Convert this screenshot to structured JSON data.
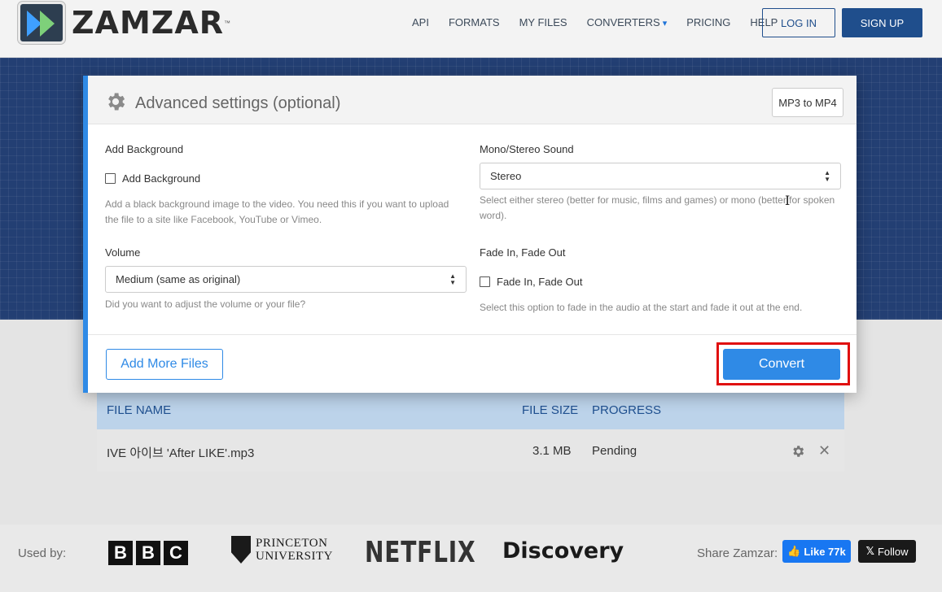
{
  "header": {
    "logo_text": "ZAMZAR",
    "logo_tm": "™",
    "nav": [
      "API",
      "FORMATS",
      "MY FILES",
      "CONVERTERS",
      "PRICING",
      "HELP"
    ],
    "login_label": "LOG IN",
    "signup_label": "SIGN UP"
  },
  "modal": {
    "title": "Advanced settings (optional)",
    "conversion_badge": "MP3 to MP4",
    "add_background": {
      "label": "Add Background",
      "checkbox_label": "Add Background",
      "checked": false,
      "help": "Add a black background image to the video. You need this if you want to upload the file to a site like Facebook, YouTube or Vimeo."
    },
    "mono_stereo": {
      "label": "Mono/Stereo Sound",
      "selected": "Stereo",
      "help": "Select either stereo (better for music, films and games) or mono (better for spoken word)."
    },
    "volume": {
      "label": "Volume",
      "selected": "Medium (same as original)",
      "help": "Did you want to adjust the volume or your file?"
    },
    "fade": {
      "label": "Fade In, Fade Out",
      "checkbox_label": "Fade In, Fade Out",
      "checked": false,
      "help": "Select this option to fade in the audio at the start and fade it out at the end."
    },
    "add_more_label": "Add More Files",
    "convert_label": "Convert"
  },
  "file_table": {
    "headers": [
      "FILE NAME",
      "FILE SIZE",
      "PROGRESS"
    ],
    "rows": [
      {
        "name": "IVE 아이브 'After LIKE'.mp3",
        "size": "3.1 MB",
        "progress": "Pending"
      }
    ]
  },
  "footer": {
    "used_by": "Used by:",
    "brands": [
      "BBC",
      "PRINCETON UNIVERSITY",
      "NETFLIX",
      "Discovery"
    ],
    "share_label": "Share Zamzar:",
    "like_label": "Like 77k",
    "follow_label": "Follow"
  },
  "colors": {
    "accent": "#2f8ae6",
    "nav_dark": "#1f4e8c",
    "hero": "#233f73",
    "highlight": "#e01010"
  }
}
